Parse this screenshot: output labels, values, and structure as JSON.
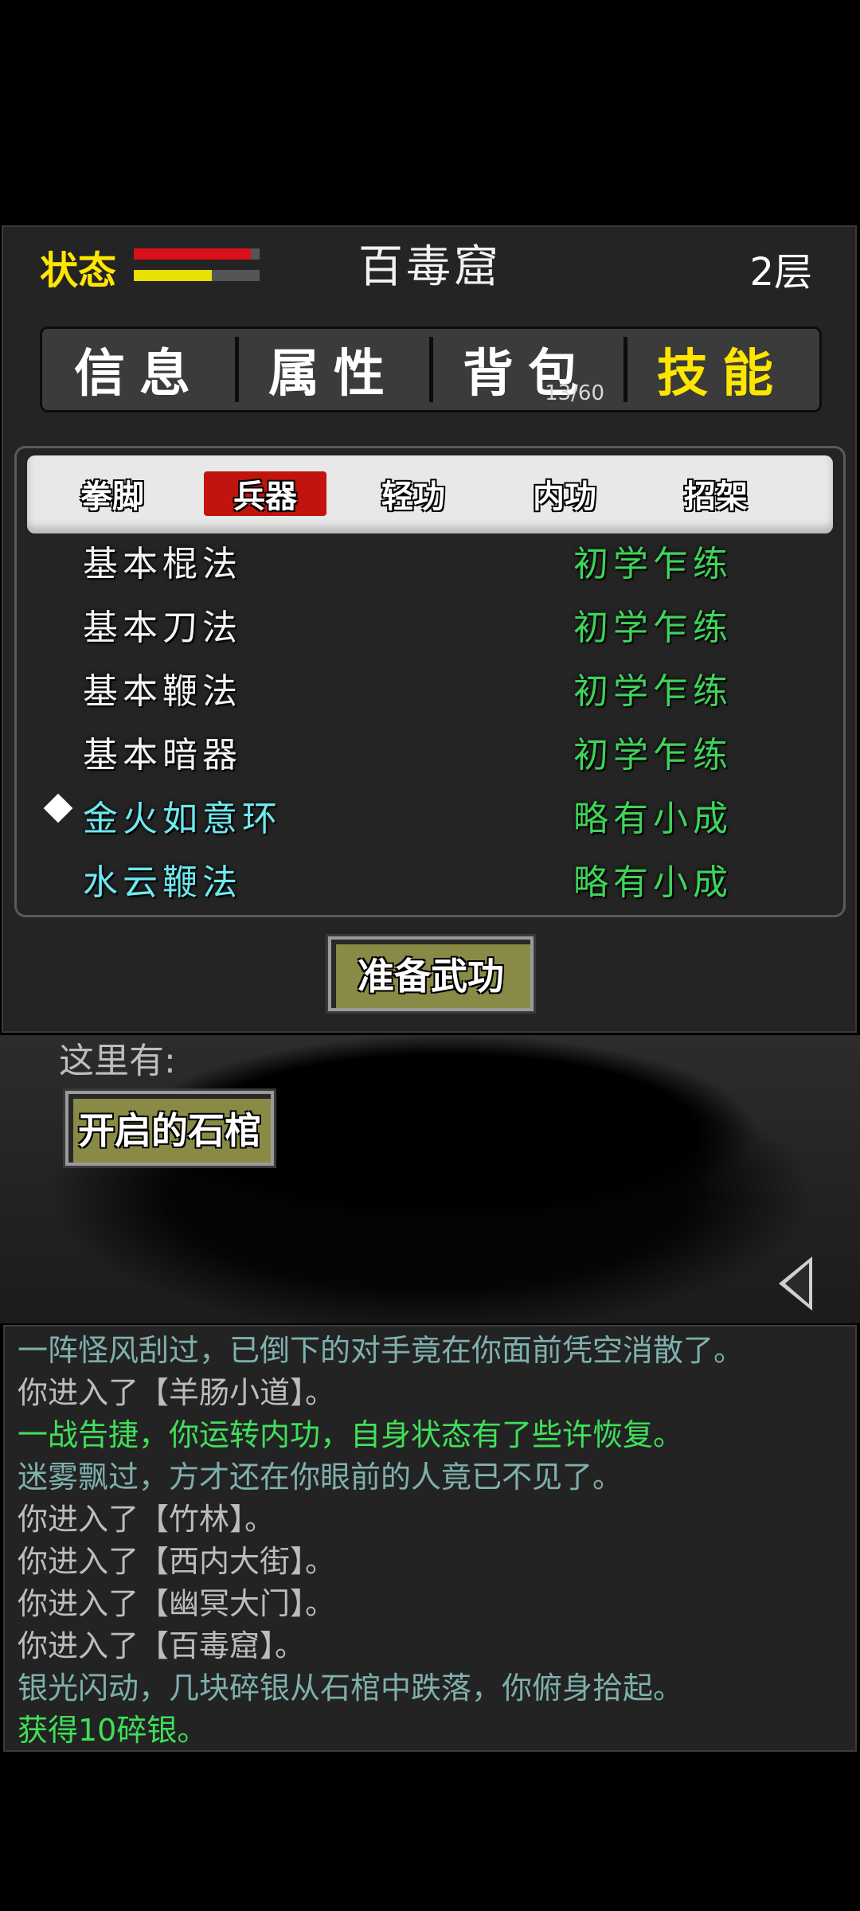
{
  "header": {
    "status_label": "状态",
    "location": "百毒窟",
    "floor": "2层",
    "health": {
      "fraction": 0.93,
      "color": "#d9101a"
    },
    "stamina": {
      "fraction": 0.62,
      "color": "#e8e000"
    }
  },
  "main_tabs": [
    {
      "label": "信息",
      "active": false
    },
    {
      "label": "属性",
      "active": false
    },
    {
      "label": "背包",
      "active": false,
      "count": "13/60"
    },
    {
      "label": "技能",
      "active": true
    }
  ],
  "sub_tabs": [
    {
      "label": "拳脚",
      "active": false
    },
    {
      "label": "兵器",
      "active": true
    },
    {
      "label": "轻功",
      "active": false
    },
    {
      "label": "内功",
      "active": false
    },
    {
      "label": "招架",
      "active": false
    }
  ],
  "skills": [
    {
      "name": "基本棍法",
      "level": "初学乍练",
      "special": false,
      "selected": false
    },
    {
      "name": "基本刀法",
      "level": "初学乍练",
      "special": false,
      "selected": false
    },
    {
      "name": "基本鞭法",
      "level": "初学乍练",
      "special": false,
      "selected": false
    },
    {
      "name": "基本暗器",
      "level": "初学乍练",
      "special": false,
      "selected": false
    },
    {
      "name": "金火如意环",
      "level": "略有小成",
      "special": true,
      "selected": true
    },
    {
      "name": "水云鞭法",
      "level": "略有小成",
      "special": true,
      "selected": false
    }
  ],
  "prepare_button": "准备武功",
  "scene": {
    "here_label": "这里有:",
    "objects": [
      "开启的石棺"
    ]
  },
  "log": [
    {
      "text": "一阵怪风刮过，已倒下的对手竟在你面前凭空消散了。",
      "color": "#7fb0ad"
    },
    {
      "text": "你进入了【羊肠小道】。",
      "color": "#bdbdbd"
    },
    {
      "text": "一战告捷，你运转内功，自身状态有了些许恢复。",
      "color": "#3fe05a"
    },
    {
      "text": "迷雾飘过，方才还在你眼前的人竟已不见了。",
      "color": "#7fb0ad"
    },
    {
      "text": "你进入了【竹林】。",
      "color": "#bdbdbd"
    },
    {
      "text": "你进入了【西内大街】。",
      "color": "#bdbdbd"
    },
    {
      "text": "你进入了【幽冥大门】。",
      "color": "#bdbdbd"
    },
    {
      "text": "你进入了【百毒窟】。",
      "color": "#bdbdbd"
    },
    {
      "text": "银光闪动，几块碎银从石棺中跌落，你俯身拾起。",
      "color": "#7fb0ad"
    },
    {
      "text": "获得10碎银。",
      "color": "#3fe05a"
    }
  ]
}
